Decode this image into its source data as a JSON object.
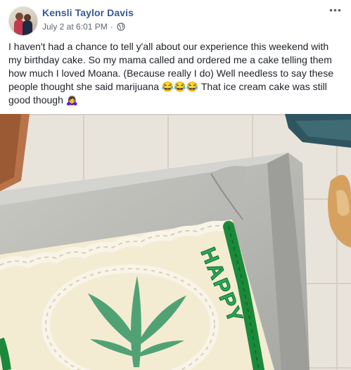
{
  "post": {
    "author_name": "Kensli Taylor Davis",
    "timestamp": "July 2 at 6:01 PM",
    "separator": "·",
    "privacy_icon": "globe-icon",
    "more_icon": "more-options-icon",
    "more_glyph": "•••",
    "body_text": "I haven't had a chance to tell y'all about our experience this weekend with my birthday cake. So my mama called and ordered me a cake telling them how much I loved Moana. (Because really I do) Well needless to say these people thought she said marijuana 😂😂😂 That ice cream cake was still good though 🙇‍♀️"
  },
  "photo": {
    "cake_text": "HAPPY",
    "icon": "cake-photo"
  },
  "colors": {
    "link_blue": "#385898",
    "meta_gray": "#616770",
    "text": "#1d2129",
    "leaf_green": "#3f9a6b",
    "icing_green": "#1a8a3a"
  }
}
